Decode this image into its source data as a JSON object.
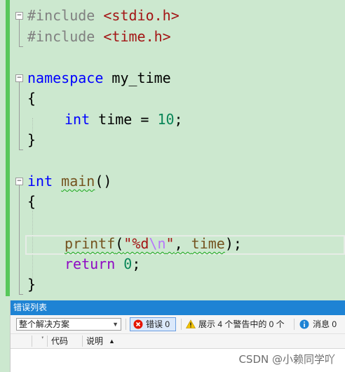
{
  "editor": {
    "line1": {
      "directive": "#include ",
      "header": "<stdio.h>"
    },
    "line2": {
      "directive": "#include ",
      "header": "<time.h>"
    },
    "line4": {
      "keyword": "namespace",
      "name": " my_time"
    },
    "brace_open": "{",
    "brace_close": "}",
    "line6": {
      "type": "int",
      "rest": " time = ",
      "value": "10",
      "end": ";"
    },
    "line10": {
      "type": "int",
      "space": " ",
      "func": "main",
      "parens": "()"
    },
    "line13": {
      "func": "printf",
      "open": "(",
      "str1": "\"%d",
      "esc": "\\n",
      "str2": "\"",
      "mid": ", ",
      "arg": "time",
      "close": ");"
    },
    "line14": {
      "keyword": "return",
      "space": " ",
      "value": "0",
      "end": ";"
    }
  },
  "error_list": {
    "title": "错误列表",
    "scope": "整个解决方案",
    "errors_label": "错误 0",
    "warnings_label": "展示 4 个警告中的 0 个",
    "messages_label": "消息 0",
    "col_code": "代码",
    "col_desc": "说明"
  },
  "watermark": "CSDN @小赖同学吖"
}
